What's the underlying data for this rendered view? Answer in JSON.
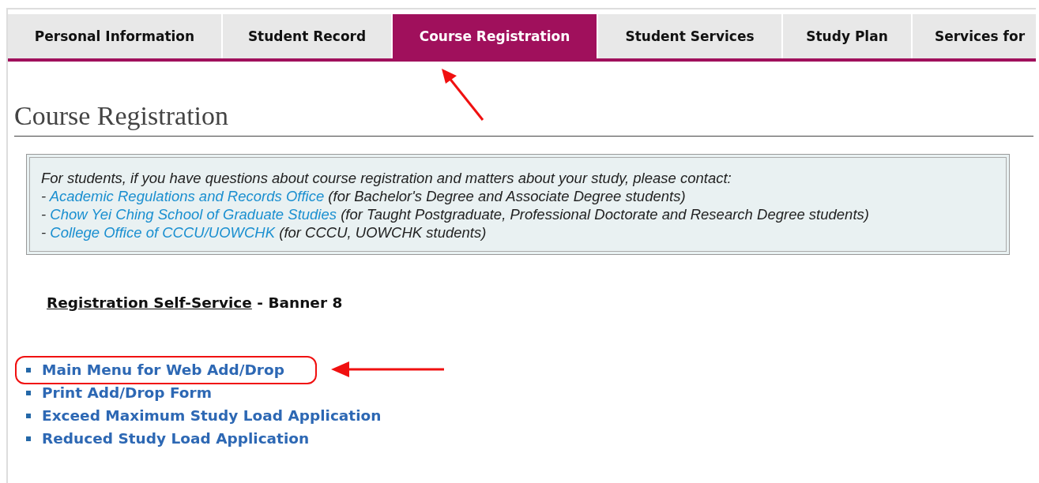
{
  "tabs": [
    {
      "label": "Personal Information",
      "selected": false,
      "annotated": false
    },
    {
      "label": "Student Record",
      "selected": false,
      "annotated": false
    },
    {
      "label": "Course Registration",
      "selected": true,
      "annotated": true
    },
    {
      "label": "Student Services",
      "selected": false,
      "annotated": false
    },
    {
      "label": "Study Plan",
      "selected": false,
      "annotated": false
    },
    {
      "label": "Services for",
      "selected": false,
      "annotated": false
    }
  ],
  "heading": "Course Registration",
  "notice": {
    "intro": "For students, if you have questions about course registration and matters about your study, please contact:",
    "contacts": [
      {
        "bullet": "-",
        "link": "Academic Regulations and Records Office",
        "note": "(for Bachelor's Degree and Associate Degree students)"
      },
      {
        "bullet": "-",
        "link": "Chow Yei Ching School of Graduate Studies",
        "note": "(for Taught Postgraduate, Professional Doctorate and Research Degree students)"
      },
      {
        "bullet": "-",
        "link": "College Office of CCCU/UOWCHK",
        "note": "(for CCCU, UOWCHK students)"
      }
    ]
  },
  "section": {
    "link": "Registration Self-Service",
    "suffix": "- Banner 8"
  },
  "links": [
    {
      "label": "Main Menu for Web Add/Drop",
      "annotated": true
    },
    {
      "label": "Print Add/Drop Form",
      "annotated": false
    },
    {
      "label": "Exceed Maximum Study Load Application",
      "annotated": false
    },
    {
      "label": "Reduced Study Load Application",
      "annotated": false
    }
  ]
}
